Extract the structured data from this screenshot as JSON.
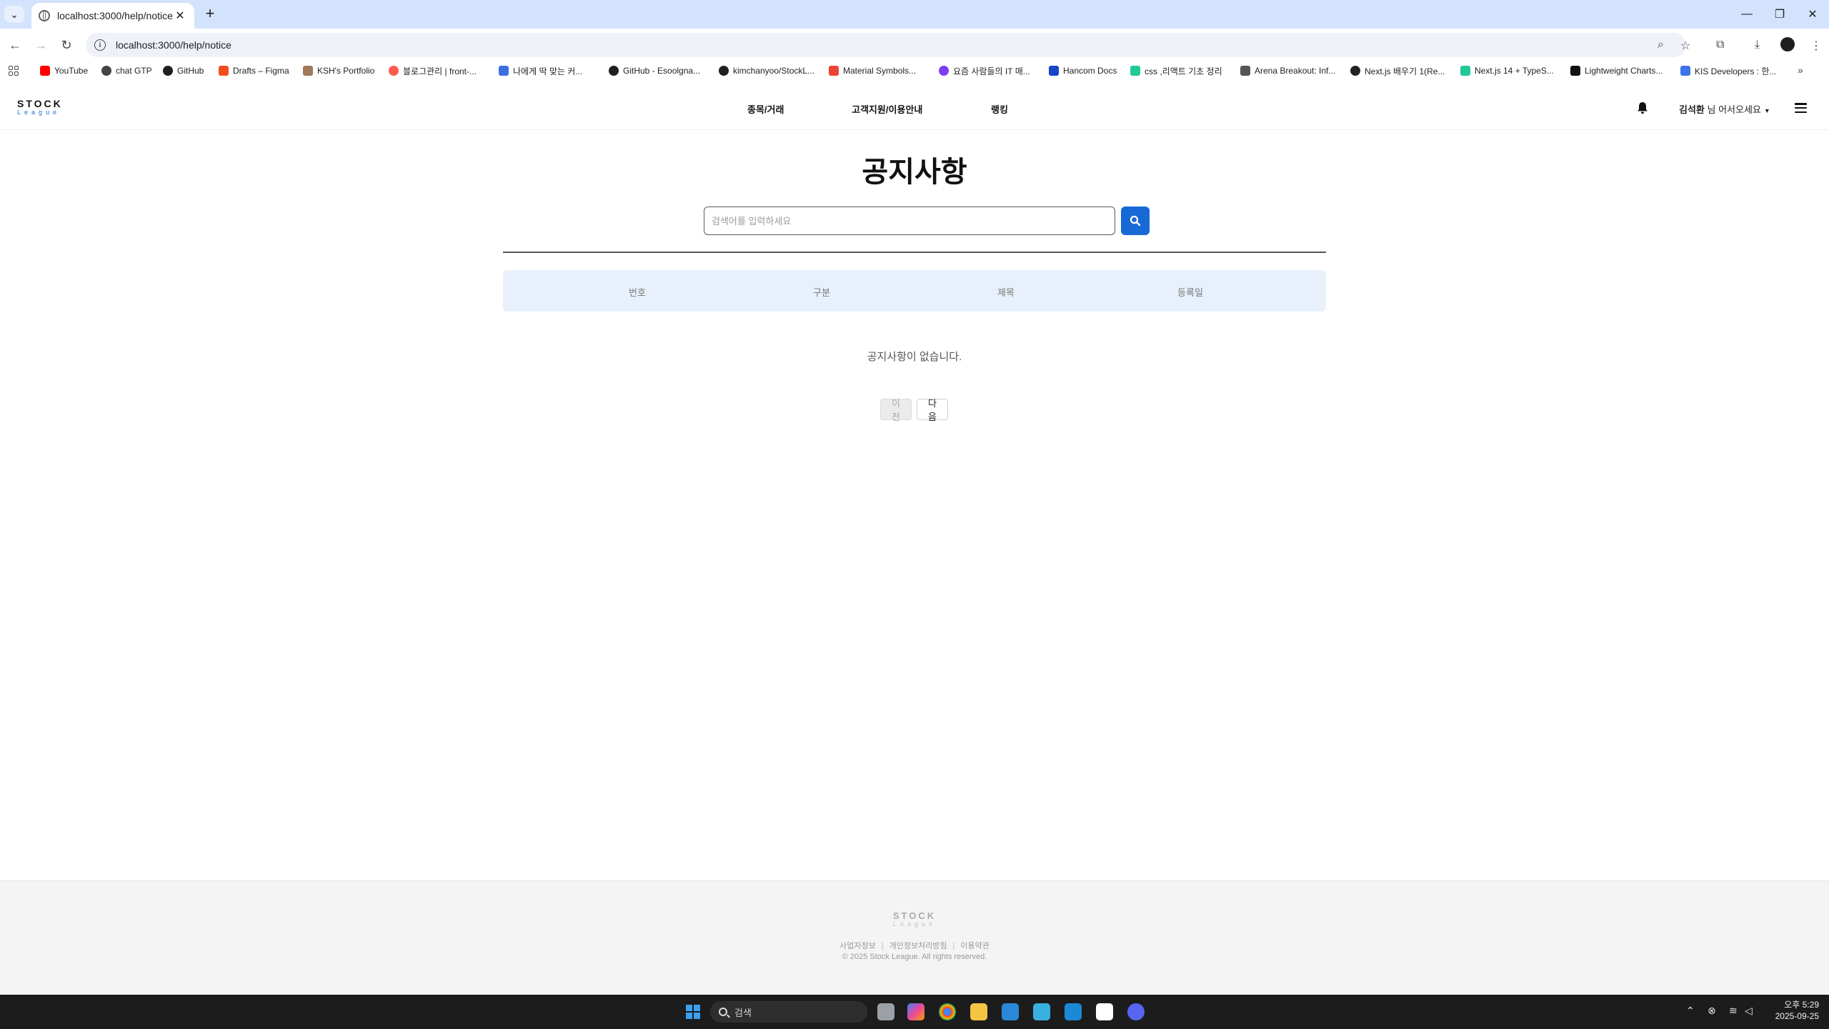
{
  "browser": {
    "tab_title": "localhost:3000/help/notice",
    "url": "localhost:3000/help/notice",
    "bookmarks": [
      {
        "label": "YouTube",
        "color": "#ff0000"
      },
      {
        "label": "chat GTP",
        "color": "#444444"
      },
      {
        "label": "GitHub",
        "color": "#1f1f1f"
      },
      {
        "label": "Drafts – Figma",
        "color": "#f24e1e"
      },
      {
        "label": "KSH's Portfolio",
        "color": "#a0785a"
      },
      {
        "label": "블로그관리 | front-...",
        "color": "#ff5a4e"
      },
      {
        "label": "나에게 딱 맞는 커...",
        "color": "#3d6ee0"
      },
      {
        "label": "GitHub - Esoolgna...",
        "color": "#1f1f1f"
      },
      {
        "label": "kimchanyoo/StockL...",
        "color": "#1f1f1f"
      },
      {
        "label": "Material Symbols...",
        "color": "#ea4335"
      },
      {
        "label": "요즘 사람들의 IT 매...",
        "color": "#7b3ff2"
      },
      {
        "label": "Hancom Docs",
        "color": "#1546c8"
      },
      {
        "label": "css ,리액트 기초 정리",
        "color": "#20c997"
      },
      {
        "label": "Arena Breakout: Inf...",
        "color": "#555555"
      },
      {
        "label": "Next.js 배우기 1(Re...",
        "color": "#222222"
      },
      {
        "label": "Next.js 14 + TypeS...",
        "color": "#20c997"
      },
      {
        "label": "Lightweight Charts...",
        "color": "#111111"
      },
      {
        "label": "KIS Developers : 한...",
        "color": "#3c73e8"
      }
    ]
  },
  "header": {
    "logo_top": "STOCK",
    "logo_bottom": "League",
    "nav": [
      "종목/거래",
      "고객지원/이용안내",
      "랭킹"
    ],
    "user_name": "김석환",
    "greeting_suffix": " 님 어서오세요"
  },
  "main": {
    "title": "공지사항",
    "search_placeholder": "검색어를 입력하세요",
    "columns": [
      "번호",
      "구분",
      "제목",
      "등록일"
    ],
    "empty_message": "공지사항이 없습니다.",
    "prev_label": "이전",
    "next_label": "다음"
  },
  "footer": {
    "logo_top": "STOCK",
    "logo_bottom": "League",
    "links": [
      "사업자정보",
      "개인정보처리방침",
      "이용약관"
    ],
    "copyright": "© 2025 Stock League. All rights reserved."
  },
  "taskbar": {
    "search_label": "검색",
    "time": "오후 5:29",
    "date": "2025-09-25"
  },
  "colors": {
    "accent": "#1769d6",
    "table_header_bg": "#e8f0fb",
    "chrome_tabbar": "#d3e3fd"
  }
}
